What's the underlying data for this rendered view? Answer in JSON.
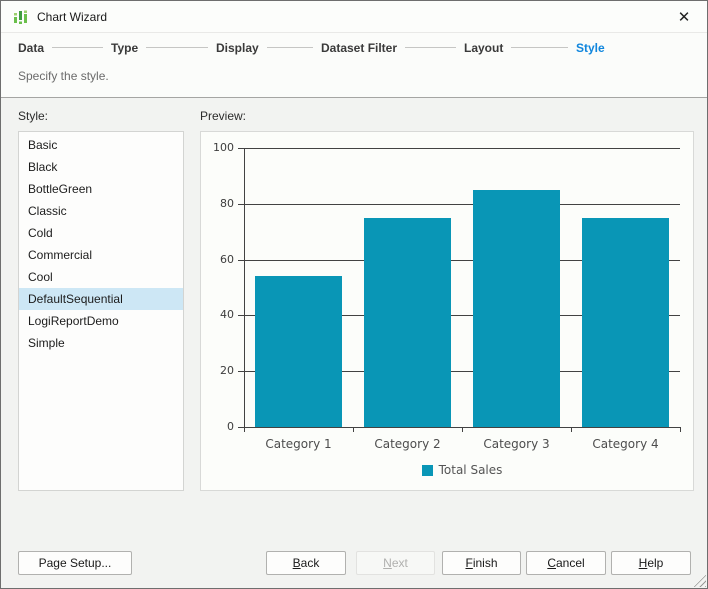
{
  "window": {
    "title": "Chart Wizard",
    "close_glyph": "✕"
  },
  "steps": {
    "items": [
      {
        "label": "Data",
        "active": false
      },
      {
        "label": "Type",
        "active": false
      },
      {
        "label": "Display",
        "active": false
      },
      {
        "label": "Dataset Filter",
        "active": false
      },
      {
        "label": "Layout",
        "active": false
      },
      {
        "label": "Style",
        "active": true
      }
    ]
  },
  "subtitle": "Specify the style.",
  "style_panel": {
    "label": "Style:",
    "items": [
      "Basic",
      "Black",
      "BottleGreen",
      "Classic",
      "Cold",
      "Commercial",
      "Cool",
      "DefaultSequential",
      "LogiReportDemo",
      "Simple"
    ],
    "selected": "DefaultSequential"
  },
  "preview": {
    "label": "Preview:"
  },
  "chart_data": {
    "type": "bar",
    "categories": [
      "Category 1",
      "Category 2",
      "Category 3",
      "Category 4"
    ],
    "series": [
      {
        "name": "Total Sales",
        "color": "#0996b6",
        "values": [
          54,
          75,
          85,
          75
        ]
      }
    ],
    "ylim": [
      0,
      100
    ],
    "yticks": [
      0,
      20,
      40,
      60,
      80,
      100
    ],
    "grid": true,
    "legend_position": "bottom"
  },
  "buttons": {
    "page_setup": {
      "label": "Page Setup..."
    },
    "back": {
      "label": "Back",
      "mnemonic": "B"
    },
    "next": {
      "label": "Next",
      "mnemonic": "N",
      "disabled": true
    },
    "finish": {
      "label": "Finish",
      "mnemonic": "F"
    },
    "cancel": {
      "label": "Cancel",
      "mnemonic": "C"
    },
    "help": {
      "label": "Help",
      "mnemonic": "H"
    }
  },
  "colors": {
    "accent_blue": "#1086dd",
    "selection_bg": "#cde7f5",
    "bar_teal": "#0996b6"
  }
}
